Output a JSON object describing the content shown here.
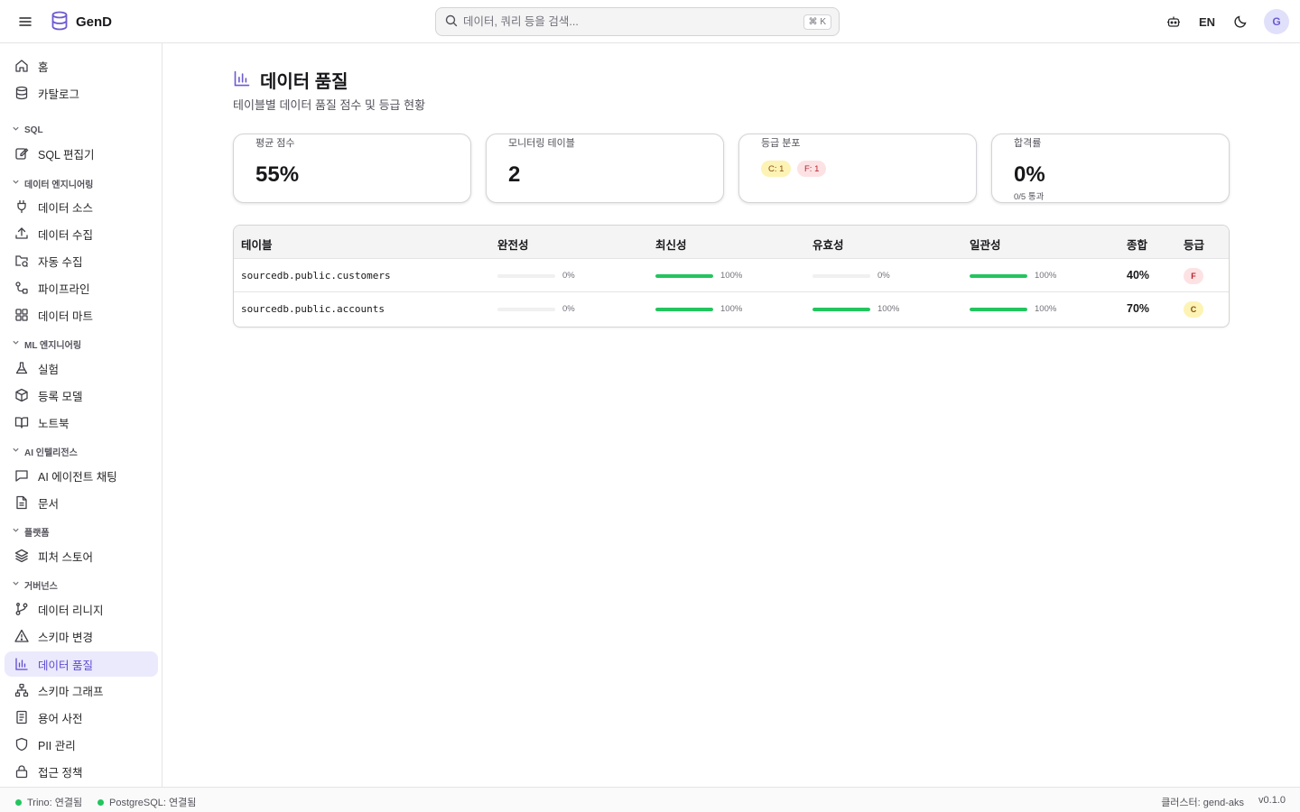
{
  "app": {
    "name": "GenD"
  },
  "search": {
    "placeholder": "데이터, 쿼리 등을 검색...",
    "shortcut": "⌘ K"
  },
  "header": {
    "lang": "EN",
    "avatar_letter": "G"
  },
  "sidebar": {
    "items": [
      {
        "label": "홈",
        "icon": "home-icon"
      },
      {
        "label": "카탈로그",
        "icon": "database-icon"
      }
    ],
    "sections": [
      {
        "title": "SQL",
        "items": [
          {
            "label": "SQL 편집기",
            "icon": "edit-icon"
          }
        ]
      },
      {
        "title": "데이터 엔지니어링",
        "items": [
          {
            "label": "데이터 소스",
            "icon": "plug-icon"
          },
          {
            "label": "데이터 수집",
            "icon": "upload-icon"
          },
          {
            "label": "자동 수집",
            "icon": "folder-sync-icon"
          },
          {
            "label": "파이프라인",
            "icon": "pipeline-icon"
          },
          {
            "label": "데이터 마트",
            "icon": "grid-icon"
          }
        ]
      },
      {
        "title": "ML 엔지니어링",
        "items": [
          {
            "label": "실험",
            "icon": "flask-icon"
          },
          {
            "label": "등록 모델",
            "icon": "package-icon"
          },
          {
            "label": "노트북",
            "icon": "book-icon"
          }
        ]
      },
      {
        "title": "AI 인텔리전스",
        "items": [
          {
            "label": "AI 에이전트 채팅",
            "icon": "chat-icon"
          },
          {
            "label": "문서",
            "icon": "document-icon"
          }
        ]
      },
      {
        "title": "플랫폼",
        "items": [
          {
            "label": "피처 스토어",
            "icon": "layers-icon"
          }
        ]
      },
      {
        "title": "거버넌스",
        "items": [
          {
            "label": "데이터 리니지",
            "icon": "git-branch-icon"
          },
          {
            "label": "스키마 변경",
            "icon": "warning-icon"
          },
          {
            "label": "데이터 품질",
            "icon": "bar-chart-icon",
            "active": true
          },
          {
            "label": "스키마 그래프",
            "icon": "network-icon"
          },
          {
            "label": "용어 사전",
            "icon": "glossary-icon"
          },
          {
            "label": "PII 관리",
            "icon": "shield-icon"
          },
          {
            "label": "접근 정책",
            "icon": "lock-icon"
          }
        ]
      }
    ]
  },
  "page": {
    "title": "데이터 품질",
    "subtitle": "테이블별 데이터 품질 점수 및 등급 현황"
  },
  "cards": {
    "avg": {
      "caption": "평균 점수",
      "value": "55%"
    },
    "monitored": {
      "caption": "모니터링 테이블",
      "value": "2"
    },
    "grades": {
      "caption": "등급 분포",
      "chip_c": "C: 1",
      "chip_f": "F: 1"
    },
    "pass": {
      "caption": "합격률",
      "value": "0%",
      "detail": "0/5 통과"
    }
  },
  "table": {
    "headers": {
      "table": "테이블",
      "completeness": "완전성",
      "freshness": "최신성",
      "validity": "유효성",
      "consistency": "일관성",
      "total": "종합",
      "grade": "등급"
    },
    "rows": [
      {
        "name": "sourcedb.public.customers",
        "completeness": "0%",
        "freshness": "100%",
        "validity": "0%",
        "consistency": "100%",
        "total": "40%",
        "grade": "F",
        "fills": {
          "completeness": 0,
          "freshness": 1,
          "validity": 0,
          "consistency": 1
        }
      },
      {
        "name": "sourcedb.public.accounts",
        "completeness": "0%",
        "freshness": "100%",
        "validity": "100%",
        "consistency": "100%",
        "total": "70%",
        "grade": "C",
        "fills": {
          "completeness": 0,
          "freshness": 1,
          "validity": 1,
          "consistency": 1
        }
      }
    ]
  },
  "colors": {
    "accent": "#5b4bd0",
    "success": "#22c55e",
    "grade_f_bg": "#fde2e4",
    "grade_f_fg": "#b4232c",
    "grade_c_bg": "#fdf3b4",
    "grade_c_fg": "#854d0e"
  },
  "footer": {
    "trino": "Trino: 연결됨",
    "postgres": "PostgreSQL: 연결됨",
    "cluster": "클러스터: gend-aks",
    "version": "v0.1.0"
  }
}
